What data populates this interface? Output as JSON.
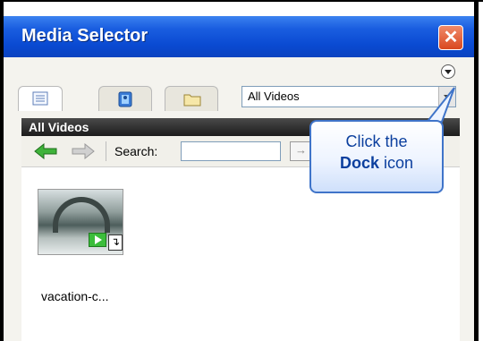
{
  "window": {
    "title": "Media Selector",
    "close_symbol": "✕"
  },
  "tabs": [
    {
      "icon": "list-icon",
      "active": true
    },
    {
      "icon": "address-book-icon",
      "active": false
    },
    {
      "icon": "folder-icon",
      "active": false
    }
  ],
  "filter": {
    "selected": "All Videos"
  },
  "section": {
    "title": "All Videos"
  },
  "toolbar": {
    "search_label": "Search:",
    "search_value": ""
  },
  "items": [
    {
      "caption": "vacation-c..."
    }
  ],
  "callout": {
    "line1": "Click the",
    "bold": "Dock",
    "rest": " icon"
  },
  "colors": {
    "titlebar": "#0a4ad2",
    "callout_border": "#3f74c9",
    "callout_text": "#0b3f9e"
  }
}
